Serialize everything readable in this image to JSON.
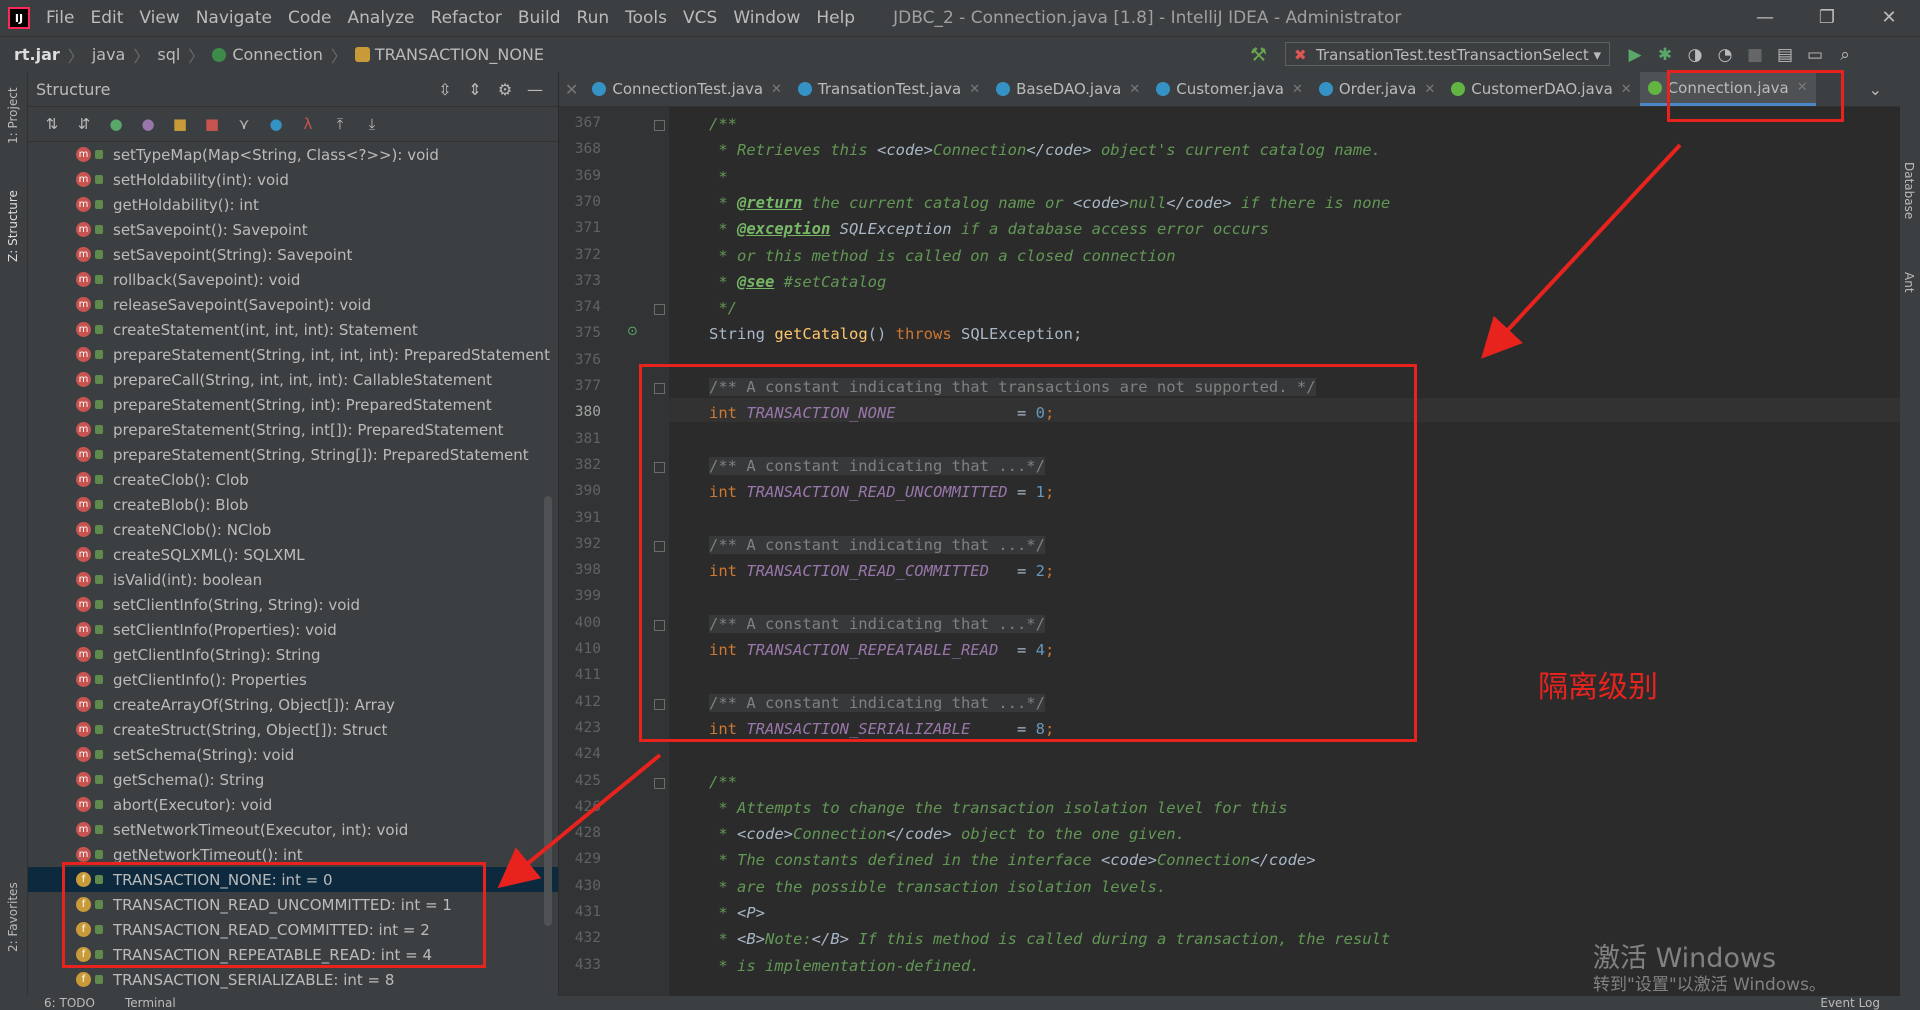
{
  "window": {
    "title": "JDBC_2 - Connection.java [1.8] - IntelliJ IDEA - Administrator",
    "menu": [
      "File",
      "Edit",
      "View",
      "Navigate",
      "Code",
      "Analyze",
      "Refactor",
      "Build",
      "Run",
      "Tools",
      "VCS",
      "Window",
      "Help"
    ],
    "controls": [
      "—",
      "❐",
      "✕"
    ]
  },
  "breadcrumb": {
    "jar": "rt.jar",
    "pkg1": "java",
    "pkg2": "sql",
    "cls": "Connection",
    "field": "TRANSACTION_NONE"
  },
  "run_config": "TransationTest.testTransactionSelect",
  "left_strip": {
    "project": "1: Project",
    "structure": "Z: Structure",
    "favorites": "2: Favorites"
  },
  "right_strip": {
    "database": "Database",
    "ant": "Ant"
  },
  "structure": {
    "title": "Structure",
    "items": [
      {
        "kind": "m",
        "text": "setTypeMap(Map<String, Class<?>>): void"
      },
      {
        "kind": "m",
        "text": "setHoldability(int): void"
      },
      {
        "kind": "m",
        "text": "getHoldability(): int"
      },
      {
        "kind": "m",
        "text": "setSavepoint(): Savepoint"
      },
      {
        "kind": "m",
        "text": "setSavepoint(String): Savepoint"
      },
      {
        "kind": "m",
        "text": "rollback(Savepoint): void"
      },
      {
        "kind": "m",
        "text": "releaseSavepoint(Savepoint): void"
      },
      {
        "kind": "m",
        "text": "createStatement(int, int, int): Statement"
      },
      {
        "kind": "m",
        "text": "prepareStatement(String, int, int, int): PreparedStatement"
      },
      {
        "kind": "m",
        "text": "prepareCall(String, int, int, int): CallableStatement"
      },
      {
        "kind": "m",
        "text": "prepareStatement(String, int): PreparedStatement"
      },
      {
        "kind": "m",
        "text": "prepareStatement(String, int[]): PreparedStatement"
      },
      {
        "kind": "m",
        "text": "prepareStatement(String, String[]): PreparedStatement"
      },
      {
        "kind": "m",
        "text": "createClob(): Clob"
      },
      {
        "kind": "m",
        "text": "createBlob(): Blob"
      },
      {
        "kind": "m",
        "text": "createNClob(): NClob"
      },
      {
        "kind": "m",
        "text": "createSQLXML(): SQLXML"
      },
      {
        "kind": "m",
        "text": "isValid(int): boolean"
      },
      {
        "kind": "m",
        "text": "setClientInfo(String, String): void"
      },
      {
        "kind": "m",
        "text": "setClientInfo(Properties): void"
      },
      {
        "kind": "m",
        "text": "getClientInfo(String): String"
      },
      {
        "kind": "m",
        "text": "getClientInfo(): Properties"
      },
      {
        "kind": "m",
        "text": "createArrayOf(String, Object[]): Array"
      },
      {
        "kind": "m",
        "text": "createStruct(String, Object[]): Struct"
      },
      {
        "kind": "m",
        "text": "setSchema(String): void"
      },
      {
        "kind": "m",
        "text": "getSchema(): String"
      },
      {
        "kind": "m",
        "text": "abort(Executor): void"
      },
      {
        "kind": "m",
        "text": "setNetworkTimeout(Executor, int): void"
      },
      {
        "kind": "m",
        "text": "getNetworkTimeout(): int"
      },
      {
        "kind": "f",
        "text": "TRANSACTION_NONE: int = 0"
      },
      {
        "kind": "f",
        "text": "TRANSACTION_READ_UNCOMMITTED: int = 1"
      },
      {
        "kind": "f",
        "text": "TRANSACTION_READ_COMMITTED: int = 2"
      },
      {
        "kind": "f",
        "text": "TRANSACTION_REPEATABLE_READ: int = 4"
      },
      {
        "kind": "f",
        "text": "TRANSACTION_SERIALIZABLE: int = 8"
      }
    ]
  },
  "tabs": [
    {
      "label": "ConnectionTest.java",
      "icon": "class-icon"
    },
    {
      "label": "TransationTest.java",
      "icon": "class-icon"
    },
    {
      "label": "BaseDAO.java",
      "icon": "class-icon"
    },
    {
      "label": "Customer.java",
      "icon": "class-icon"
    },
    {
      "label": "Order.java",
      "icon": "class-icon"
    },
    {
      "label": "CustomerDAO.java",
      "icon": "interface-icon"
    },
    {
      "label": "Connection.java",
      "icon": "interface-icon"
    }
  ],
  "line_numbers": [
    "367",
    "368",
    "369",
    "370",
    "371",
    "372",
    "373",
    "374",
    "375",
    "376",
    "377",
    "380",
    "381",
    "382",
    "390",
    "391",
    "392",
    "398",
    "399",
    "400",
    "410",
    "411",
    "412",
    "423",
    "424",
    "425",
    "426",
    "428",
    "429",
    "430",
    "431",
    "432",
    "433"
  ],
  "code": {
    "l367": "/**",
    "l368a": " * Retrieves this ",
    "l368b": "<code>",
    "l368c": "Connection",
    "l368d": "</code>",
    "l368e": " object's current catalog name.",
    "l369": " *",
    "l370a": " * ",
    "l370b": "@return",
    "l370c": " the current catalog name or ",
    "l370d": "<code>",
    "l370e": "null",
    "l370f": "</code>",
    "l370g": " if there is none",
    "l371a": " * ",
    "l371b": "@exception",
    "l371c": " SQLException",
    "l371d": " if a database access error occurs",
    "l372": " * or this method is called on a closed connection",
    "l373a": " * ",
    "l373b": "@see",
    "l373c": " #setCatalog",
    "l374": " */",
    "l375a": "String ",
    "l375b": "getCatalog",
    "l375c": "() ",
    "l375d": "throws",
    "l375e": " SQLException;",
    "l377": "/** A constant indicating that transactions are not supported. */",
    "l380a": "int ",
    "l380b": "TRANSACTION_NONE",
    "l380c": "             = ",
    "l380d": "0",
    "l380e": ";",
    "fold_comment": "/** A constant indicating that ...*/",
    "l390a": "int ",
    "l390b": "TRANSACTION_READ_UNCOMMITTED",
    "l390c": " = ",
    "l390d": "1",
    "l390e": ";",
    "l398a": "int ",
    "l398b": "TRANSACTION_READ_COMMITTED",
    "l398c": "   = ",
    "l398d": "2",
    "l398e": ";",
    "l410a": "int ",
    "l410b": "TRANSACTION_REPEATABLE_READ",
    "l410c": "  = ",
    "l410d": "4",
    "l410e": ";",
    "l423a": "int ",
    "l423b": "TRANSACTION_SERIALIZABLE",
    "l423c": "     = ",
    "l423d": "8",
    "l423e": ";",
    "l425": "/**",
    "l426": " * Attempts to change the transaction isolation level for this",
    "l428a": " * ",
    "l428b": "<code>",
    "l428c": "Connection",
    "l428d": "</code>",
    "l428e": " object to the one given.",
    "l429a": " * The constants defined in the interface ",
    "l429b": "<code>",
    "l429c": "Connection",
    "l429d": "</code>",
    "l430": " * are the possible transaction isolation levels.",
    "l431a": " * ",
    "l431b": "<P>",
    "l432a": " * ",
    "l432b": "<B>",
    "l432c": "Note:",
    "l432d": "</B>",
    "l432e": " If this method is called during a transaction, the result",
    "l433": " * is implementation-defined."
  },
  "annotation": "隔离级别",
  "watermark": {
    "line1": "激活 Windows",
    "line2": "转到\"设置\"以激活 Windows。"
  },
  "statusbar": {
    "todo": "6: TODO",
    "terminal": "Terminal",
    "eventlog": "Event Log"
  }
}
